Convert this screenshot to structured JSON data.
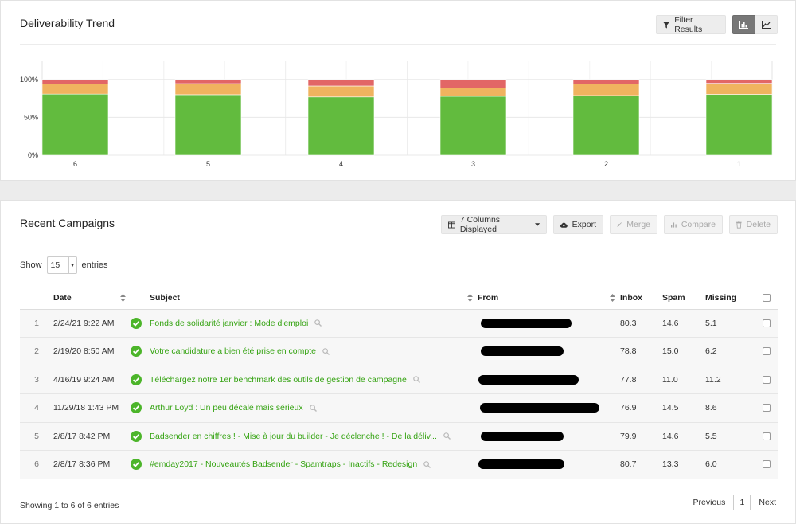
{
  "trend": {
    "title": "Deliverability Trend",
    "filter_label": "Filter Results",
    "view_icons": [
      "bar-chart-icon",
      "line-chart-icon"
    ]
  },
  "chart_data": {
    "type": "bar",
    "stacked": true,
    "categories": [
      "6",
      "5",
      "4",
      "3",
      "2",
      "1"
    ],
    "series": [
      {
        "values": [
          80.7,
          79.9,
          76.9,
          77.8,
          78.8,
          80.3
        ],
        "color": "#62bb3e"
      },
      {
        "values": [
          13.3,
          14.6,
          14.5,
          11.0,
          15.0,
          14.6
        ],
        "color": "#f0b35f"
      },
      {
        "values": [
          6.0,
          5.5,
          8.6,
          11.2,
          6.2,
          5.1
        ],
        "color": "#e26666"
      }
    ],
    "yticks": [
      "0%",
      "50%",
      "100%"
    ],
    "ylim": [
      0,
      100
    ],
    "grid": true
  },
  "campaigns": {
    "title": "Recent Campaigns",
    "toolbar": {
      "columns_label": "7 Columns Displayed",
      "export_label": "Export",
      "merge_label": "Merge",
      "compare_label": "Compare",
      "delete_label": "Delete"
    },
    "show_label": "Show",
    "page_size": "15",
    "entries_label": "entries",
    "columns": {
      "date": "Date",
      "subject": "Subject",
      "from": "From",
      "inbox": "Inbox",
      "spam": "Spam",
      "missing": "Missing"
    },
    "rows": [
      {
        "num": "1",
        "date": "2/24/21 9:22 AM",
        "subject": "Fonds de solidarité janvier : Mode d'emploi",
        "inbox": "80.3",
        "spam": "14.6",
        "missing": "5.1"
      },
      {
        "num": "2",
        "date": "2/19/20 8:50 AM",
        "subject": "Votre candidature a bien été prise en compte",
        "inbox": "78.8",
        "spam": "15.0",
        "missing": "6.2"
      },
      {
        "num": "3",
        "date": "4/16/19 9:24 AM",
        "subject": "Téléchargez notre 1er benchmark des outils de gestion de campagne",
        "inbox": "77.8",
        "spam": "11.0",
        "missing": "11.2"
      },
      {
        "num": "4",
        "date": "11/29/18 1:43 PM",
        "subject": "Arthur Loyd : Un peu décalé mais sérieux",
        "inbox": "76.9",
        "spam": "14.5",
        "missing": "8.6"
      },
      {
        "num": "5",
        "date": "2/8/17 8:42 PM",
        "subject": "Badsender en chiffres ! - Mise à jour du builder - Je déclenche ! - De la déliv...",
        "inbox": "79.9",
        "spam": "14.6",
        "missing": "5.5"
      },
      {
        "num": "6",
        "date": "2/8/17 8:36 PM",
        "subject": "#emday2017 - Nouveautés Badsender - Spamtraps - Inactifs - Redesign",
        "inbox": "80.7",
        "spam": "13.3",
        "missing": "6.0"
      }
    ],
    "footer_info": "Showing 1 to 6 of 6 entries",
    "pagination": {
      "previous": "Previous",
      "current": "1",
      "next": "Next"
    }
  }
}
